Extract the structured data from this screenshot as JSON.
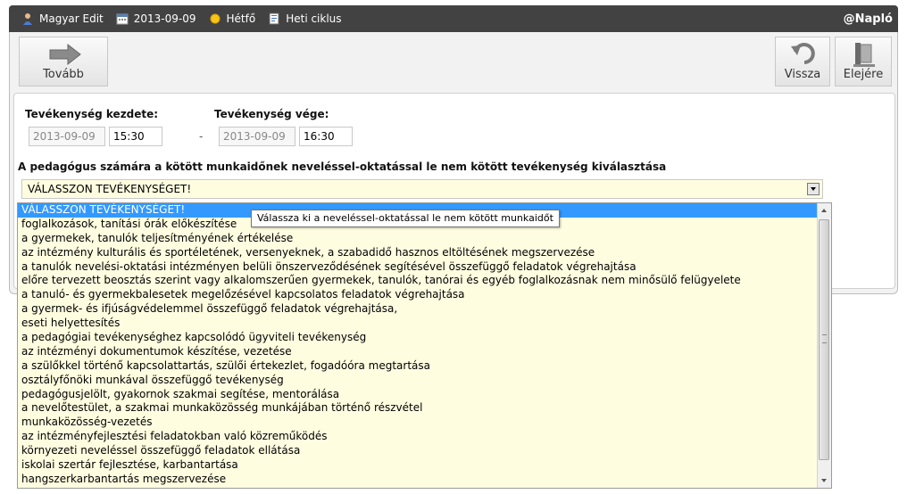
{
  "topbar": {
    "user": "Magyar Edit",
    "date": "2013-09-09",
    "day": "Hétfő",
    "cycle": "Heti ciklus",
    "brand": "@Napló"
  },
  "toolbar": {
    "next_label": "Tovább",
    "back_label": "Vissza",
    "start_label": "Elejére"
  },
  "form": {
    "start_label": "Tevékenység kezdete:",
    "end_label": "Tevékenység vége:",
    "start_date": "2013-09-09",
    "start_time": "15:30",
    "separator": "-",
    "end_date": "2013-09-09",
    "end_time": "16:30",
    "activity_label": "A pedagógus számára a kötött munkaidőnek neveléssel-oktatással le nem kötött tevékenység kiválasztása",
    "selected": "VÁLASSZON TEVÉKENYSÉGET!"
  },
  "tooltip": "Válassza ki a neveléssel-oktatással le nem kötött munkaidőt",
  "options": [
    "VÁLASSZON TEVÉKENYSÉGET!",
    "foglalkozások, tanítási órák előkészítése",
    "a gyermekek, tanulók teljesítményének értékelése",
    "az intézmény kulturális és sportéletének, versenyeknek, a szabadidő hasznos eltöltésének megszervezése",
    "a tanulók nevelési-oktatási intézményen belüli önszerveződésének segítésével összefüggő feladatok végrehajtása",
    "előre tervezett beosztás szerint vagy alkalomszerűen gyermekek, tanulók, tanórai és egyéb foglalkozásnak nem minősülő felügyelete",
    "a tanuló- és gyermekbalesetek megelőzésével kapcsolatos feladatok végrehajtása",
    "a gyermek- és ifjúságvédelemmel összefüggő feladatok végrehajtása,",
    "eseti helyettesítés",
    "a pedagógiai tevékenységhez kapcsolódó ügyviteli tevékenység",
    "az intézményi dokumentumok készítése, vezetése",
    "a szülőkkel történő kapcsolattartás, szülői értekezlet, fogadóóra megtartása",
    "osztályfőnöki munkával összefüggő tevékenység",
    "pedagógusjelölt, gyakornok szakmai segítése, mentorálása",
    "a nevelőtestület, a szakmai munkaközösség munkájában történő részvétel",
    "munkaközösség-vezetés",
    "az intézményfejlesztési feladatokban való közreműködés",
    "környezeti neveléssel összefüggő feladatok ellátása",
    "iskolai szertár fejlesztése, karbantartása",
    "hangszerkarbantartás megszervezése"
  ]
}
